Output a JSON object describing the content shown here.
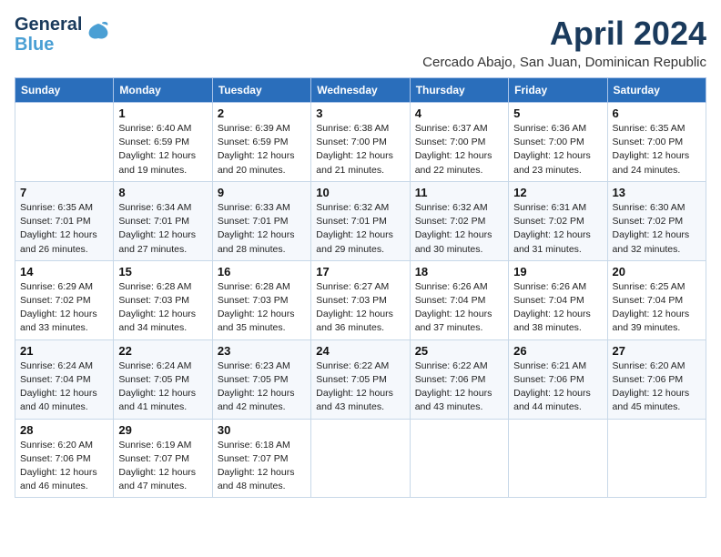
{
  "header": {
    "logo_line1": "General",
    "logo_line2": "Blue",
    "month_year": "April 2024",
    "location": "Cercado Abajo, San Juan, Dominican Republic"
  },
  "weekdays": [
    "Sunday",
    "Monday",
    "Tuesday",
    "Wednesday",
    "Thursday",
    "Friday",
    "Saturday"
  ],
  "weeks": [
    [
      {
        "day": "",
        "info": ""
      },
      {
        "day": "1",
        "info": "Sunrise: 6:40 AM\nSunset: 6:59 PM\nDaylight: 12 hours\nand 19 minutes."
      },
      {
        "day": "2",
        "info": "Sunrise: 6:39 AM\nSunset: 6:59 PM\nDaylight: 12 hours\nand 20 minutes."
      },
      {
        "day": "3",
        "info": "Sunrise: 6:38 AM\nSunset: 7:00 PM\nDaylight: 12 hours\nand 21 minutes."
      },
      {
        "day": "4",
        "info": "Sunrise: 6:37 AM\nSunset: 7:00 PM\nDaylight: 12 hours\nand 22 minutes."
      },
      {
        "day": "5",
        "info": "Sunrise: 6:36 AM\nSunset: 7:00 PM\nDaylight: 12 hours\nand 23 minutes."
      },
      {
        "day": "6",
        "info": "Sunrise: 6:35 AM\nSunset: 7:00 PM\nDaylight: 12 hours\nand 24 minutes."
      }
    ],
    [
      {
        "day": "7",
        "info": "Sunrise: 6:35 AM\nSunset: 7:01 PM\nDaylight: 12 hours\nand 26 minutes."
      },
      {
        "day": "8",
        "info": "Sunrise: 6:34 AM\nSunset: 7:01 PM\nDaylight: 12 hours\nand 27 minutes."
      },
      {
        "day": "9",
        "info": "Sunrise: 6:33 AM\nSunset: 7:01 PM\nDaylight: 12 hours\nand 28 minutes."
      },
      {
        "day": "10",
        "info": "Sunrise: 6:32 AM\nSunset: 7:01 PM\nDaylight: 12 hours\nand 29 minutes."
      },
      {
        "day": "11",
        "info": "Sunrise: 6:32 AM\nSunset: 7:02 PM\nDaylight: 12 hours\nand 30 minutes."
      },
      {
        "day": "12",
        "info": "Sunrise: 6:31 AM\nSunset: 7:02 PM\nDaylight: 12 hours\nand 31 minutes."
      },
      {
        "day": "13",
        "info": "Sunrise: 6:30 AM\nSunset: 7:02 PM\nDaylight: 12 hours\nand 32 minutes."
      }
    ],
    [
      {
        "day": "14",
        "info": "Sunrise: 6:29 AM\nSunset: 7:02 PM\nDaylight: 12 hours\nand 33 minutes."
      },
      {
        "day": "15",
        "info": "Sunrise: 6:28 AM\nSunset: 7:03 PM\nDaylight: 12 hours\nand 34 minutes."
      },
      {
        "day": "16",
        "info": "Sunrise: 6:28 AM\nSunset: 7:03 PM\nDaylight: 12 hours\nand 35 minutes."
      },
      {
        "day": "17",
        "info": "Sunrise: 6:27 AM\nSunset: 7:03 PM\nDaylight: 12 hours\nand 36 minutes."
      },
      {
        "day": "18",
        "info": "Sunrise: 6:26 AM\nSunset: 7:04 PM\nDaylight: 12 hours\nand 37 minutes."
      },
      {
        "day": "19",
        "info": "Sunrise: 6:26 AM\nSunset: 7:04 PM\nDaylight: 12 hours\nand 38 minutes."
      },
      {
        "day": "20",
        "info": "Sunrise: 6:25 AM\nSunset: 7:04 PM\nDaylight: 12 hours\nand 39 minutes."
      }
    ],
    [
      {
        "day": "21",
        "info": "Sunrise: 6:24 AM\nSunset: 7:04 PM\nDaylight: 12 hours\nand 40 minutes."
      },
      {
        "day": "22",
        "info": "Sunrise: 6:24 AM\nSunset: 7:05 PM\nDaylight: 12 hours\nand 41 minutes."
      },
      {
        "day": "23",
        "info": "Sunrise: 6:23 AM\nSunset: 7:05 PM\nDaylight: 12 hours\nand 42 minutes."
      },
      {
        "day": "24",
        "info": "Sunrise: 6:22 AM\nSunset: 7:05 PM\nDaylight: 12 hours\nand 43 minutes."
      },
      {
        "day": "25",
        "info": "Sunrise: 6:22 AM\nSunset: 7:06 PM\nDaylight: 12 hours\nand 43 minutes."
      },
      {
        "day": "26",
        "info": "Sunrise: 6:21 AM\nSunset: 7:06 PM\nDaylight: 12 hours\nand 44 minutes."
      },
      {
        "day": "27",
        "info": "Sunrise: 6:20 AM\nSunset: 7:06 PM\nDaylight: 12 hours\nand 45 minutes."
      }
    ],
    [
      {
        "day": "28",
        "info": "Sunrise: 6:20 AM\nSunset: 7:06 PM\nDaylight: 12 hours\nand 46 minutes."
      },
      {
        "day": "29",
        "info": "Sunrise: 6:19 AM\nSunset: 7:07 PM\nDaylight: 12 hours\nand 47 minutes."
      },
      {
        "day": "30",
        "info": "Sunrise: 6:18 AM\nSunset: 7:07 PM\nDaylight: 12 hours\nand 48 minutes."
      },
      {
        "day": "",
        "info": ""
      },
      {
        "day": "",
        "info": ""
      },
      {
        "day": "",
        "info": ""
      },
      {
        "day": "",
        "info": ""
      }
    ]
  ]
}
